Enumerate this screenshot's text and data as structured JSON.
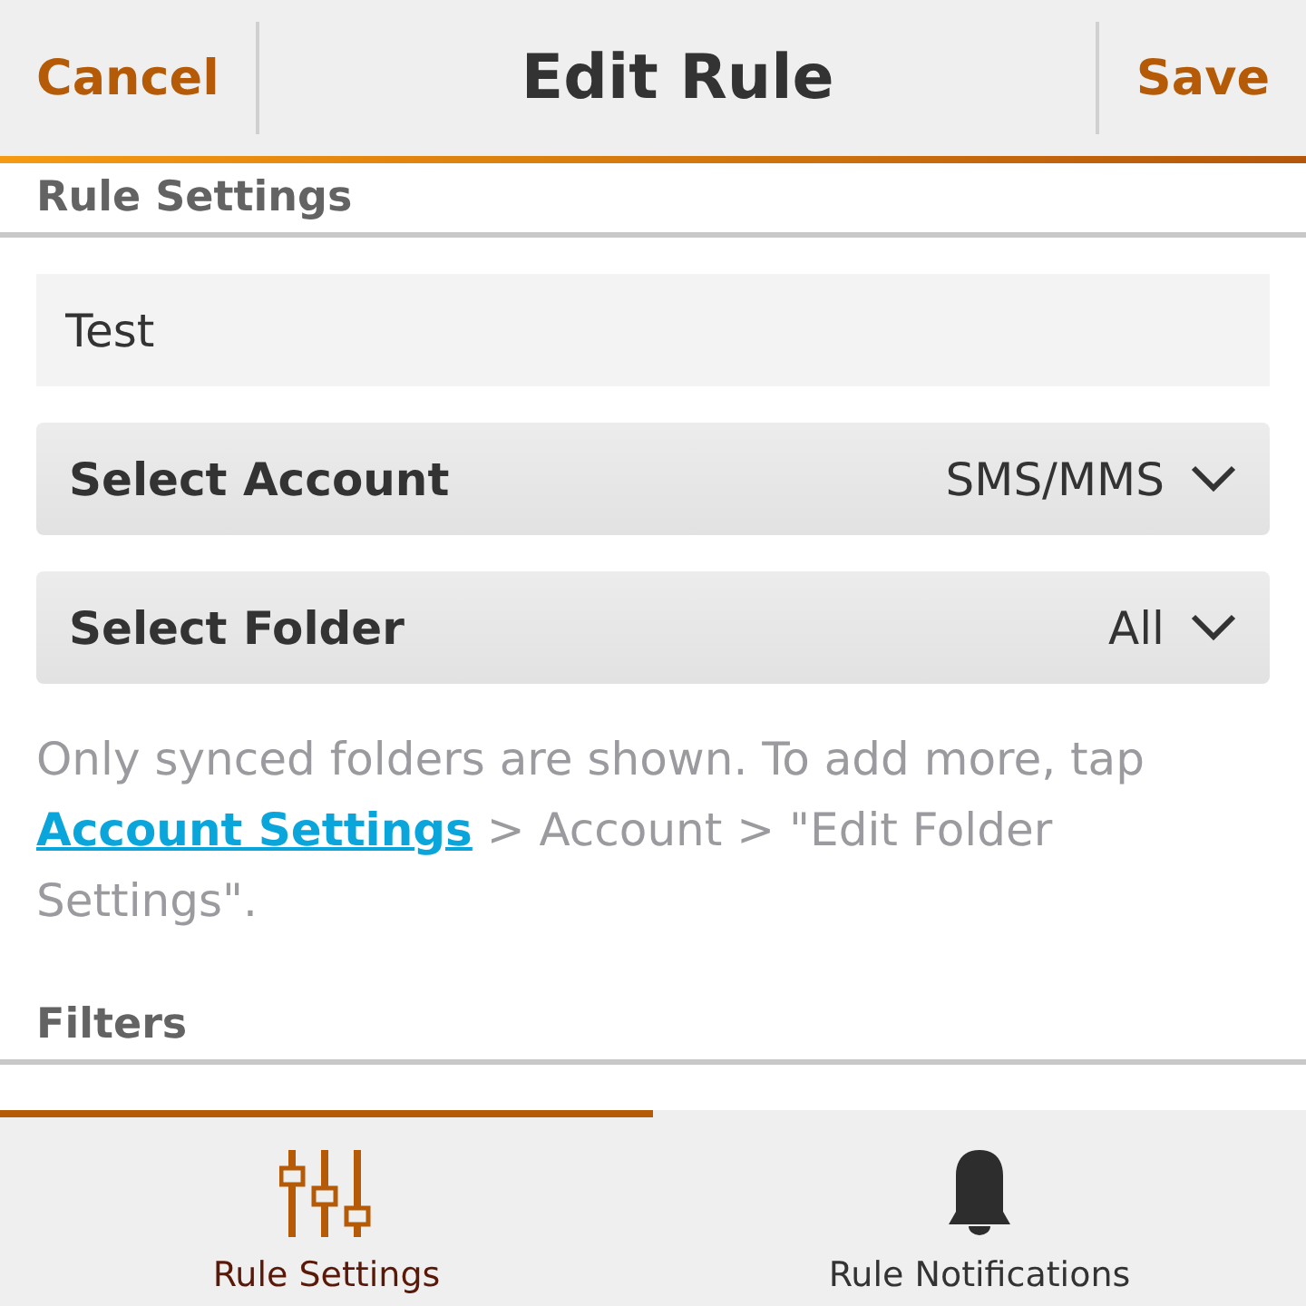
{
  "title_bar": {
    "cancel": "Cancel",
    "title": "Edit Rule",
    "save": "Save"
  },
  "sections": [
    {
      "title": "Rule Settings"
    },
    {
      "title": "Filters"
    }
  ],
  "name_field": {
    "value": "Test"
  },
  "dropdowns": [
    {
      "label": "Select Account",
      "value": "SMS/MMS"
    },
    {
      "label": "Select Folder",
      "value": "All"
    }
  ],
  "help": {
    "before": "Only synced folders are shown. To add more, tap ",
    "link": "Account Settings",
    "after": " > Account > \"Edit Folder Settings\"."
  },
  "tabs": [
    {
      "label": "Rule Settings",
      "selected": true
    },
    {
      "label": "Rule Notifications",
      "selected": false
    }
  ]
}
